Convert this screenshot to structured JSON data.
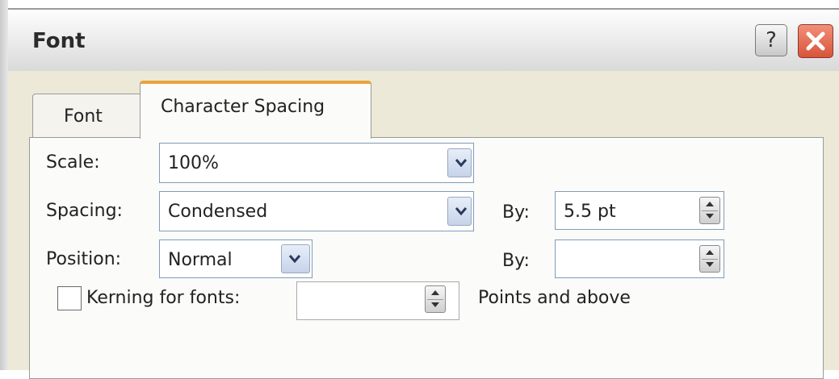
{
  "window": {
    "title": "Font",
    "help_label": "?",
    "close_icon": "close-icon"
  },
  "tabs": [
    {
      "label": "Font",
      "active": false
    },
    {
      "label": "Character Spacing",
      "active": true
    }
  ],
  "scale": {
    "label": "Scale:",
    "value": "100%"
  },
  "spacing": {
    "label": "Spacing:",
    "value": "Condensed",
    "by_label": "By:",
    "by_value": "5.5 pt"
  },
  "position": {
    "label": "Position:",
    "value": "Normal",
    "by_label": "By:",
    "by_value": ""
  },
  "kerning": {
    "label": "Kerning for fonts:",
    "value": "",
    "suffix": "Points and above",
    "checked": false
  },
  "colors": {
    "accent_tab": "#e9a33b",
    "close_red": "#d8543a",
    "field_border": "#7f9db9"
  }
}
